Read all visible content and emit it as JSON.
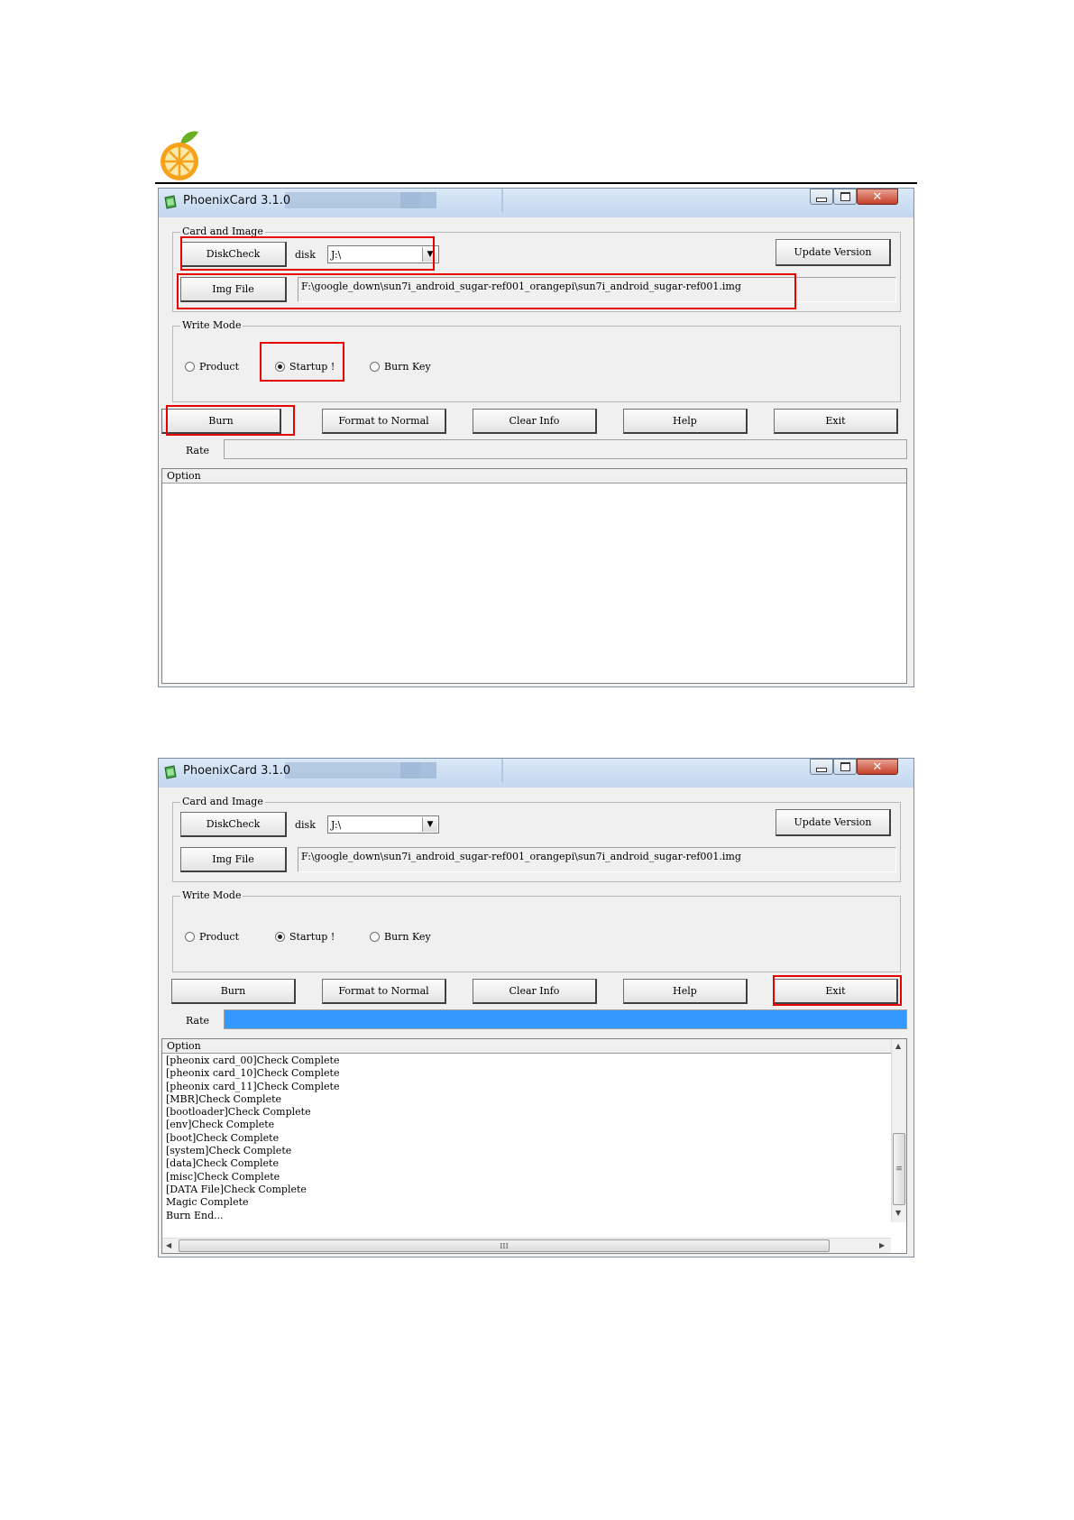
{
  "window": {
    "title": "PhoenixCard 3.1.0",
    "minimize_glyph": "",
    "close_glyph": "✕"
  },
  "card_group": {
    "label": "Card and Image",
    "diskcheck_label": "DiskCheck",
    "disk_label": "disk",
    "disk_value": "J:\\",
    "update_label": "Update Version",
    "imgfile_label": "Img File",
    "img_path": "F:\\google_down\\sun7i_android_sugar-ref001_orangepi\\sun7i_android_sugar-ref001.img"
  },
  "mode_group": {
    "label": "Write Mode",
    "options": [
      "Product",
      "Startup !",
      "Burn Key"
    ],
    "selected": "Startup !"
  },
  "actions": {
    "burn": "Burn",
    "format": "Format to Normal",
    "clear": "Clear Info",
    "help": "Help",
    "exit": "Exit"
  },
  "rate_label": "Rate",
  "log": {
    "header": "Option",
    "scroll_grip_v": "≡",
    "scroll_grip_h": "III"
  },
  "before": {
    "rate_progress": 0.0,
    "log_lines": []
  },
  "after": {
    "rate_progress": 1.0,
    "log_lines": [
      "[pheonix card_00]Check Complete",
      "[pheonix card_10]Check Complete",
      "[pheonix card_11]Check Complete",
      "[MBR]Check Complete",
      "[bootloader]Check Complete",
      "[env]Check Complete",
      "[boot]Check Complete",
      "[system]Check Complete",
      "[data]Check Complete",
      "[misc]Check Complete",
      "[DATA File]Check Complete",
      "Magic Complete",
      "Burn End..."
    ]
  },
  "colors": {
    "highlight": "#e60000",
    "progress": "#3399ff",
    "logo_orange": "#f7a21b",
    "logo_leaf": "#6ab023"
  }
}
